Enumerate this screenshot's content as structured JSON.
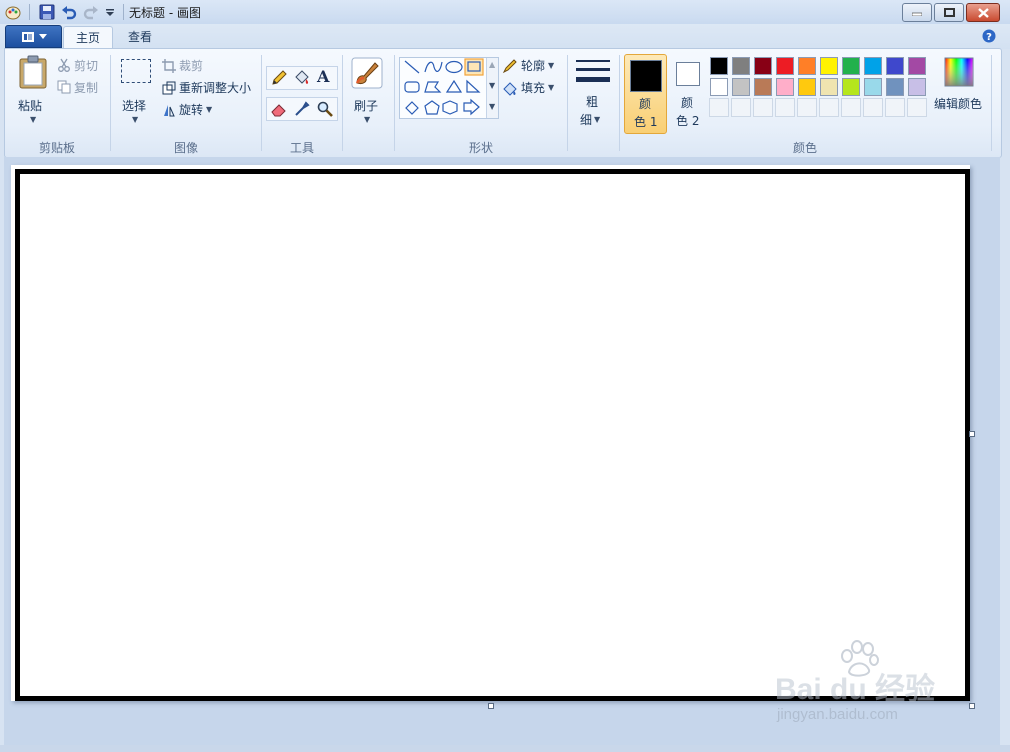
{
  "window": {
    "title": "无标题 - 画图"
  },
  "tabs": {
    "home": "主页",
    "view": "查看"
  },
  "clipboard": {
    "paste": "粘贴",
    "cut": "剪切",
    "copy": "复制",
    "group": "剪贴板"
  },
  "image": {
    "select": "选择",
    "crop": "裁剪",
    "resize": "重新调整大小",
    "rotate": "旋转",
    "group": "图像"
  },
  "tools": {
    "group": "工具",
    "text_icon": "A"
  },
  "brushes": {
    "label": "刷子"
  },
  "shapes": {
    "outline": "轮廓",
    "fill": "填充",
    "group": "形状"
  },
  "size": {
    "label_line1": "粗",
    "label_line2": "细"
  },
  "colors": {
    "color1_line1": "颜",
    "color1_line2": "色 1",
    "color2_line1": "颜",
    "color2_line2": "色 2",
    "edit": "编辑颜色",
    "group": "颜色",
    "color1_value": "#000000",
    "color2_value": "#ffffff",
    "palette_row1": [
      "#000000",
      "#7f7f7f",
      "#880015",
      "#ed1c24",
      "#ff7f27",
      "#fff200",
      "#22b14c",
      "#00a2e8",
      "#3f48cc",
      "#a349a4"
    ],
    "palette_row2": [
      "#ffffff",
      "#c3c3c3",
      "#b97a57",
      "#ffaec9",
      "#ffc90e",
      "#efe4b0",
      "#b5e61d",
      "#99d9ea",
      "#7092be",
      "#c8bfe7"
    ]
  },
  "watermark": {
    "brand": "Bai du 经验",
    "url": "jingyan.baidu.com"
  }
}
